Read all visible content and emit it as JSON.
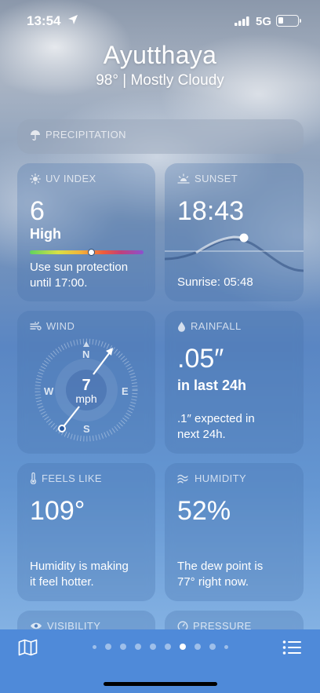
{
  "status": {
    "time": "13:54",
    "network": "5G"
  },
  "header": {
    "city": "Ayutthaya",
    "summary": "98°  |  Mostly Cloudy"
  },
  "precipitation": {
    "title": "PRECIPITATION"
  },
  "uv": {
    "title": "UV INDEX",
    "value": "6",
    "level": "High",
    "note_line1": "Use sun protection",
    "note_line2": "until 17:00.",
    "position": 0.54
  },
  "sunset": {
    "title": "SUNSET",
    "time": "18:43",
    "sunrise": "Sunrise: 05:48"
  },
  "wind": {
    "title": "WIND",
    "speed": "7",
    "unit": "mph",
    "n": "N",
    "e": "E",
    "s": "S",
    "w": "W"
  },
  "rainfall": {
    "title": "RAINFALL",
    "amount": ".05″",
    "period": "in last 24h",
    "note_line1": ".1″ expected in",
    "note_line2": "next 24h."
  },
  "feels_like": {
    "title": "FEELS LIKE",
    "value": "109°",
    "note_line1": "Humidity is making",
    "note_line2": "it feel hotter."
  },
  "humidity": {
    "title": "HUMIDITY",
    "value": "52%",
    "note_line1": "The dew point is",
    "note_line2": "77° right now."
  },
  "visibility": {
    "title": "VISIBILITY"
  },
  "pressure": {
    "title": "PRESSURE"
  },
  "tabbar": {
    "map_icon": "map-icon",
    "list_icon": "list-icon",
    "page_count": 10,
    "active_page": 6
  },
  "colors": {
    "tabbar": "#4f8ad9",
    "card": "rgba(70,110,170,0.28)"
  }
}
